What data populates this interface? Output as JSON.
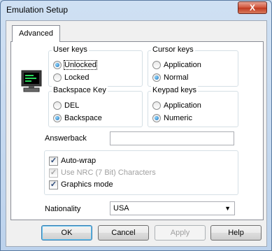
{
  "window": {
    "title": "Emulation Setup",
    "close_label": "X"
  },
  "tab": {
    "label": "Advanced"
  },
  "user_keys": {
    "label": "User keys",
    "options": [
      {
        "label": "Unlocked",
        "selected": true
      },
      {
        "label": "Locked",
        "selected": false
      }
    ]
  },
  "cursor_keys": {
    "label": "Cursor keys",
    "options": [
      {
        "label": "Application",
        "selected": false
      },
      {
        "label": "Normal",
        "selected": true
      }
    ]
  },
  "backspace_key": {
    "label": "Backspace Key",
    "options": [
      {
        "label": "DEL",
        "selected": false
      },
      {
        "label": "Backspace",
        "selected": true
      }
    ]
  },
  "keypad_keys": {
    "label": "Keypad keys",
    "options": [
      {
        "label": "Application",
        "selected": false
      },
      {
        "label": "Numeric",
        "selected": true
      }
    ]
  },
  "answerback": {
    "label": "Answerback",
    "value": ""
  },
  "checkboxes": [
    {
      "label": "Auto-wrap",
      "checked": true,
      "enabled": true
    },
    {
      "label": "Use NRC (7 Bit) Characters",
      "checked": true,
      "enabled": false
    },
    {
      "label": "Graphics mode",
      "checked": true,
      "enabled": true
    }
  ],
  "nationality": {
    "label": "Nationality",
    "value": "USA"
  },
  "buttons": {
    "ok": "OK",
    "cancel": "Cancel",
    "apply": "Apply",
    "help": "Help"
  },
  "colors": {
    "accent": "#1d6fb5",
    "title_bar": "#c9dbf0",
    "close_button": "#c0381f"
  }
}
